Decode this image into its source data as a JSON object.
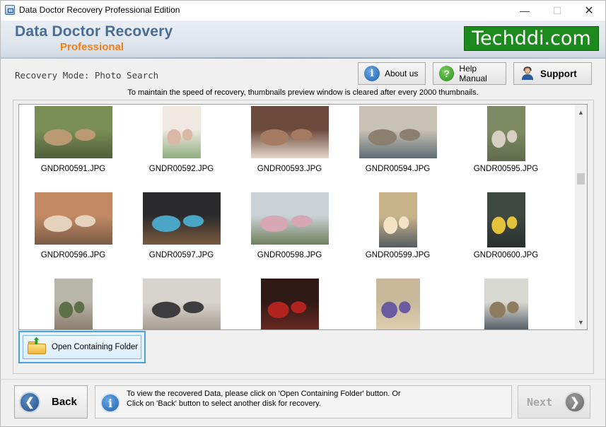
{
  "window": {
    "title": "Data Doctor Recovery Professional Edition",
    "min_glyph": "—",
    "max_glyph": "☐",
    "close_glyph": "✕"
  },
  "header": {
    "title": "Data Doctor Recovery",
    "subtitle": "Professional",
    "brand": "Techddi.com"
  },
  "mode_label": "Recovery Mode: Photo Search",
  "top_buttons": {
    "about": "About us",
    "help": "Help Manual",
    "support": "Support"
  },
  "notice": "To maintain the speed of recovery, thumbnails preview window is cleared after every 2000 thumbnails.",
  "thumbnails": [
    {
      "name": "GNDR00591.JPG",
      "colors": [
        "#7a8f55",
        "#b99a72",
        "#4f5e3a"
      ]
    },
    {
      "name": "GNDR00592.JPG",
      "colors": [
        "#efe9e2",
        "#d9b8a6",
        "#8fae7e"
      ]
    },
    {
      "name": "GNDR00593.JPG",
      "colors": [
        "#6b4a3c",
        "#a57b62",
        "#e6d9c8"
      ]
    },
    {
      "name": "GNDR00594.JPG",
      "colors": [
        "#c9c3b6",
        "#8c7f6f",
        "#5e6c73"
      ]
    },
    {
      "name": "GNDR00595.JPG",
      "colors": [
        "#7d8a63",
        "#d8cfc3",
        "#5f6b4c"
      ]
    },
    {
      "name": "GNDR00596.JPG",
      "colors": [
        "#c28a63",
        "#e6d1bd",
        "#7b5a45"
      ]
    },
    {
      "name": "GNDR00597.JPG",
      "colors": [
        "#2b2a2c",
        "#4aa6c6",
        "#7a5a3e"
      ]
    },
    {
      "name": "GNDR00598.JPG",
      "colors": [
        "#c9d3d6",
        "#d8a7b5",
        "#6f7e5a"
      ]
    },
    {
      "name": "GNDR00599.JPG",
      "colors": [
        "#c7b28a",
        "#f2e2c6",
        "#545c62"
      ]
    },
    {
      "name": "GNDR00600.JPG",
      "colors": [
        "#3c4840",
        "#e4c23c",
        "#2a2f2e"
      ]
    },
    {
      "name": "",
      "colors": [
        "#b8b5a9",
        "#5e7048",
        "#8a7a6a"
      ]
    },
    {
      "name": "",
      "colors": [
        "#d7d4cf",
        "#3d3d3f",
        "#a69a8c"
      ]
    },
    {
      "name": "",
      "colors": [
        "#301a16",
        "#b2231e",
        "#6a2a22"
      ]
    },
    {
      "name": "",
      "colors": [
        "#c9b89a",
        "#6a5aa2",
        "#e0d0b0"
      ]
    },
    {
      "name": "",
      "colors": [
        "#d8d8d2",
        "#8f7b5d",
        "#505a62"
      ]
    }
  ],
  "open_folder_label": "Open Containing Folder",
  "back_label": "Back",
  "next_label": "Next",
  "info": {
    "line1": "To view the recovered Data, please click on 'Open Containing Folder' button. Or",
    "line2": "Click on 'Back' button to select another disk for recovery."
  }
}
